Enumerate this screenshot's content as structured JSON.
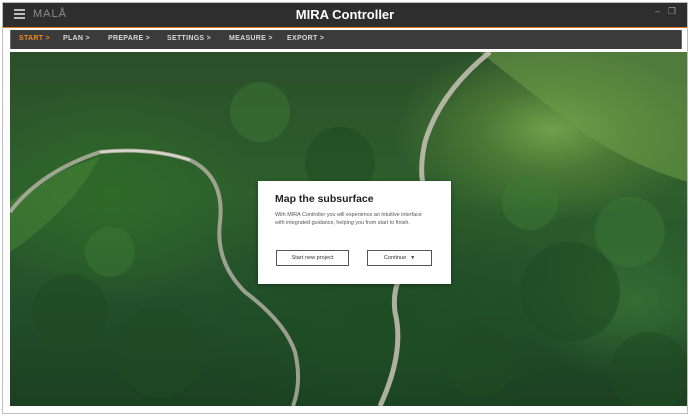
{
  "window": {
    "brand": "MALÅ",
    "title": "MIRA Controller",
    "controls": [
      "–",
      "❐"
    ]
  },
  "nav": {
    "items": [
      {
        "label": "START >",
        "active": true
      },
      {
        "label": "PLAN >",
        "active": false
      },
      {
        "label": "PREPARE >",
        "active": false
      },
      {
        "label": "SETTINGS >",
        "active": false
      },
      {
        "label": "MEASURE >",
        "active": false
      },
      {
        "label": "EXPORT >",
        "active": false
      }
    ]
  },
  "dialog": {
    "title": "Map the subsurface",
    "body": "With MIRA Controller you will experience an intuitive interface with integrated guidance, helping you from start to finish.",
    "start_button": "Start new project",
    "continue_button": "Continue"
  },
  "colors": {
    "accent": "#f08a24",
    "titlebar": "#2e2e2e",
    "navbar": "#3b3b3b"
  },
  "icons": {
    "menu": "hamburger-menu-icon",
    "dropdown": "caret-down-icon"
  }
}
